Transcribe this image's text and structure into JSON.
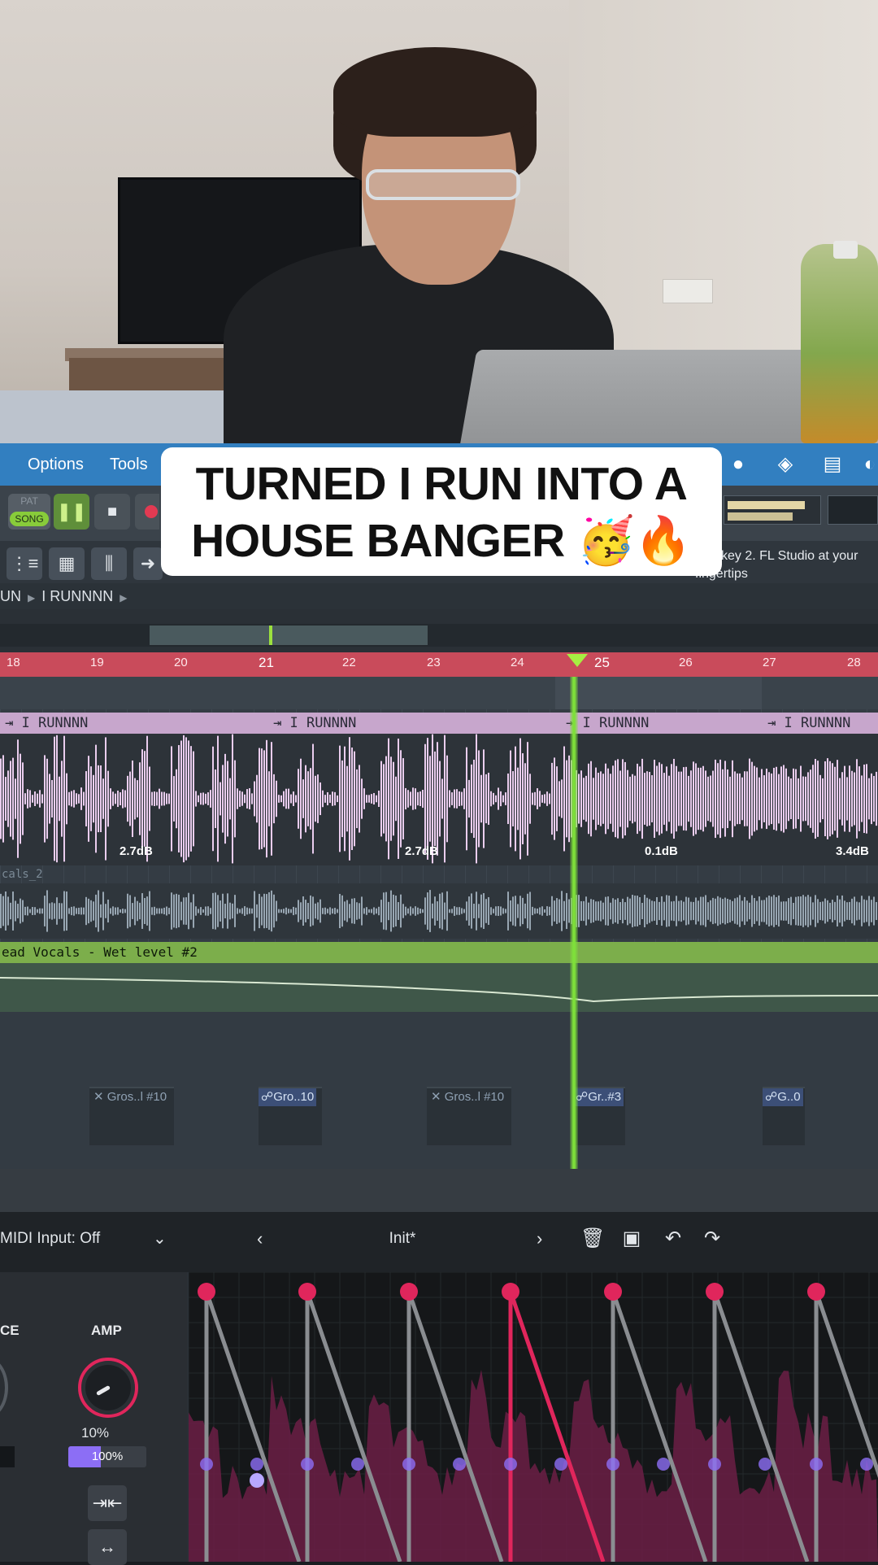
{
  "caption": {
    "line1": "TURNED I RUN INTO A",
    "line2": "HOUSE BANGER 🥳🔥"
  },
  "menubar": {
    "items": [
      "Options",
      "Tools"
    ]
  },
  "transport": {
    "pat_label": "PAT",
    "song_label": "SONG",
    "pause_icon": "❚❚",
    "stop_icon": "■",
    "hint_text": "5  FLkey 2. FL Studio at your fingertips"
  },
  "breadcrumb": {
    "items": [
      "UN",
      "I RUNNNN"
    ]
  },
  "ruler": {
    "bars": [
      "18",
      "19",
      "20",
      "21",
      "22",
      "23",
      "24",
      "25",
      "26",
      "27",
      "28"
    ]
  },
  "playlist": {
    "clips": [
      {
        "label": "I RUNNNN",
        "gain": "2.7dB"
      },
      {
        "label": "I RUNNNN",
        "gain": "2.7dB"
      },
      {
        "label": "I RUNNNN",
        "gain": "0.1dB"
      },
      {
        "label": "I RUNNNN",
        "gain": "3.4dB"
      }
    ],
    "vocals_track": "cals_2",
    "automation_clip": "ead Vocals - Wet level #2",
    "patterns": [
      {
        "label": "Gros..l #10",
        "type": "cut"
      },
      {
        "label": "Gro..10",
        "type": "linked"
      },
      {
        "label": "Gros..l #10",
        "type": "cut"
      },
      {
        "label": "Gr..#3",
        "type": "linked"
      },
      {
        "label": "G..0",
        "type": "linked"
      }
    ]
  },
  "plugin": {
    "midi_input": "MIDI Input: Off",
    "preset_name": "Init*",
    "left_label": "CE",
    "amp_label": "AMP",
    "amp_value": "10%",
    "mix_value": "100%",
    "mix_fraction": 1.0,
    "accent_color": "#e0265c",
    "purple_color": "#8c6ef5"
  }
}
